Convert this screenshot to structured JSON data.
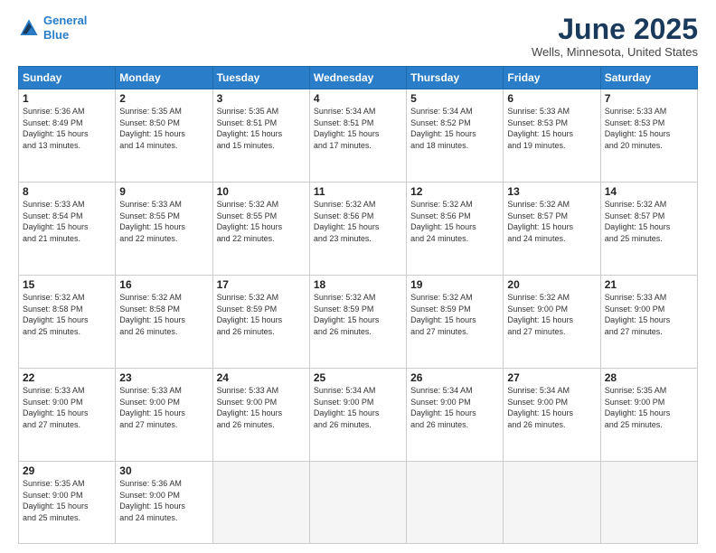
{
  "header": {
    "logo_line1": "General",
    "logo_line2": "Blue",
    "title": "June 2025",
    "location": "Wells, Minnesota, United States"
  },
  "days_of_week": [
    "Sunday",
    "Monday",
    "Tuesday",
    "Wednesday",
    "Thursday",
    "Friday",
    "Saturday"
  ],
  "weeks": [
    [
      {
        "day": 1,
        "info": "Sunrise: 5:36 AM\nSunset: 8:49 PM\nDaylight: 15 hours\nand 13 minutes."
      },
      {
        "day": 2,
        "info": "Sunrise: 5:35 AM\nSunset: 8:50 PM\nDaylight: 15 hours\nand 14 minutes."
      },
      {
        "day": 3,
        "info": "Sunrise: 5:35 AM\nSunset: 8:51 PM\nDaylight: 15 hours\nand 15 minutes."
      },
      {
        "day": 4,
        "info": "Sunrise: 5:34 AM\nSunset: 8:51 PM\nDaylight: 15 hours\nand 17 minutes."
      },
      {
        "day": 5,
        "info": "Sunrise: 5:34 AM\nSunset: 8:52 PM\nDaylight: 15 hours\nand 18 minutes."
      },
      {
        "day": 6,
        "info": "Sunrise: 5:33 AM\nSunset: 8:53 PM\nDaylight: 15 hours\nand 19 minutes."
      },
      {
        "day": 7,
        "info": "Sunrise: 5:33 AM\nSunset: 8:53 PM\nDaylight: 15 hours\nand 20 minutes."
      }
    ],
    [
      {
        "day": 8,
        "info": "Sunrise: 5:33 AM\nSunset: 8:54 PM\nDaylight: 15 hours\nand 21 minutes."
      },
      {
        "day": 9,
        "info": "Sunrise: 5:33 AM\nSunset: 8:55 PM\nDaylight: 15 hours\nand 22 minutes."
      },
      {
        "day": 10,
        "info": "Sunrise: 5:32 AM\nSunset: 8:55 PM\nDaylight: 15 hours\nand 22 minutes."
      },
      {
        "day": 11,
        "info": "Sunrise: 5:32 AM\nSunset: 8:56 PM\nDaylight: 15 hours\nand 23 minutes."
      },
      {
        "day": 12,
        "info": "Sunrise: 5:32 AM\nSunset: 8:56 PM\nDaylight: 15 hours\nand 24 minutes."
      },
      {
        "day": 13,
        "info": "Sunrise: 5:32 AM\nSunset: 8:57 PM\nDaylight: 15 hours\nand 24 minutes."
      },
      {
        "day": 14,
        "info": "Sunrise: 5:32 AM\nSunset: 8:57 PM\nDaylight: 15 hours\nand 25 minutes."
      }
    ],
    [
      {
        "day": 15,
        "info": "Sunrise: 5:32 AM\nSunset: 8:58 PM\nDaylight: 15 hours\nand 25 minutes."
      },
      {
        "day": 16,
        "info": "Sunrise: 5:32 AM\nSunset: 8:58 PM\nDaylight: 15 hours\nand 26 minutes."
      },
      {
        "day": 17,
        "info": "Sunrise: 5:32 AM\nSunset: 8:59 PM\nDaylight: 15 hours\nand 26 minutes."
      },
      {
        "day": 18,
        "info": "Sunrise: 5:32 AM\nSunset: 8:59 PM\nDaylight: 15 hours\nand 26 minutes."
      },
      {
        "day": 19,
        "info": "Sunrise: 5:32 AM\nSunset: 8:59 PM\nDaylight: 15 hours\nand 27 minutes."
      },
      {
        "day": 20,
        "info": "Sunrise: 5:32 AM\nSunset: 9:00 PM\nDaylight: 15 hours\nand 27 minutes."
      },
      {
        "day": 21,
        "info": "Sunrise: 5:33 AM\nSunset: 9:00 PM\nDaylight: 15 hours\nand 27 minutes."
      }
    ],
    [
      {
        "day": 22,
        "info": "Sunrise: 5:33 AM\nSunset: 9:00 PM\nDaylight: 15 hours\nand 27 minutes."
      },
      {
        "day": 23,
        "info": "Sunrise: 5:33 AM\nSunset: 9:00 PM\nDaylight: 15 hours\nand 27 minutes."
      },
      {
        "day": 24,
        "info": "Sunrise: 5:33 AM\nSunset: 9:00 PM\nDaylight: 15 hours\nand 26 minutes."
      },
      {
        "day": 25,
        "info": "Sunrise: 5:34 AM\nSunset: 9:00 PM\nDaylight: 15 hours\nand 26 minutes."
      },
      {
        "day": 26,
        "info": "Sunrise: 5:34 AM\nSunset: 9:00 PM\nDaylight: 15 hours\nand 26 minutes."
      },
      {
        "day": 27,
        "info": "Sunrise: 5:34 AM\nSunset: 9:00 PM\nDaylight: 15 hours\nand 26 minutes."
      },
      {
        "day": 28,
        "info": "Sunrise: 5:35 AM\nSunset: 9:00 PM\nDaylight: 15 hours\nand 25 minutes."
      }
    ],
    [
      {
        "day": 29,
        "info": "Sunrise: 5:35 AM\nSunset: 9:00 PM\nDaylight: 15 hours\nand 25 minutes."
      },
      {
        "day": 30,
        "info": "Sunrise: 5:36 AM\nSunset: 9:00 PM\nDaylight: 15 hours\nand 24 minutes."
      },
      null,
      null,
      null,
      null,
      null
    ]
  ]
}
